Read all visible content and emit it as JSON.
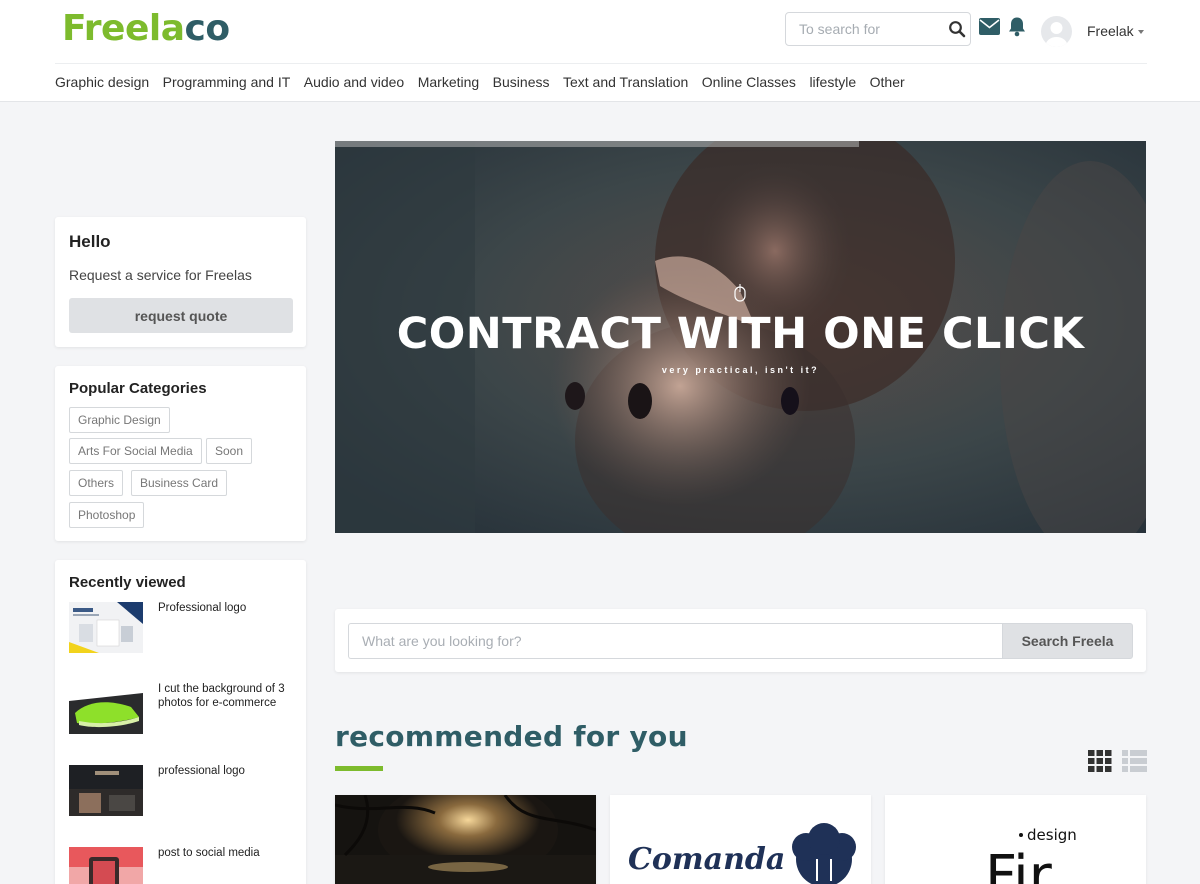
{
  "header": {
    "logo_part1": "Freela",
    "logo_part2": "co",
    "search_placeholder": "To search for",
    "username": "Freelak",
    "accent_color": "#7dbb2d",
    "brand_color": "#2f5d66"
  },
  "nav": {
    "items": [
      "Graphic design",
      "Programming and IT",
      "Audio and video",
      "Marketing",
      "Business",
      "Text and Translation",
      "Online Classes",
      "lifestyle",
      "Other"
    ]
  },
  "sidebar": {
    "hello": {
      "title": "Hello",
      "subtitle": "Request a service for Freelas",
      "button": "request quote"
    },
    "popular": {
      "title": "Popular Categories",
      "tags": [
        "Graphic Design",
        "Arts For Social Media",
        "Soon",
        "Others",
        "Business Card",
        "Photoshop"
      ]
    },
    "recent": {
      "title": "Recently viewed",
      "items": [
        {
          "title": "Professional logo"
        },
        {
          "title": "I cut the background of 3 photos for e-commerce"
        },
        {
          "title": "professional logo"
        },
        {
          "title": "post to social media"
        }
      ]
    }
  },
  "hero": {
    "headline": "CONTRACT WITH ONE CLICK",
    "subtitle": "very practical, isn't it?"
  },
  "search": {
    "placeholder": "What are you looking for?",
    "button": "Search Freela"
  },
  "recommended": {
    "title": "recommended for you",
    "cards": [
      {
        "image": "sunset-landscape"
      },
      {
        "image": "comanda-logo",
        "logo_text": "Comanda"
      },
      {
        "image": "fir-design-logo",
        "logo_text": "Fir",
        "logo_small": "design"
      }
    ]
  }
}
